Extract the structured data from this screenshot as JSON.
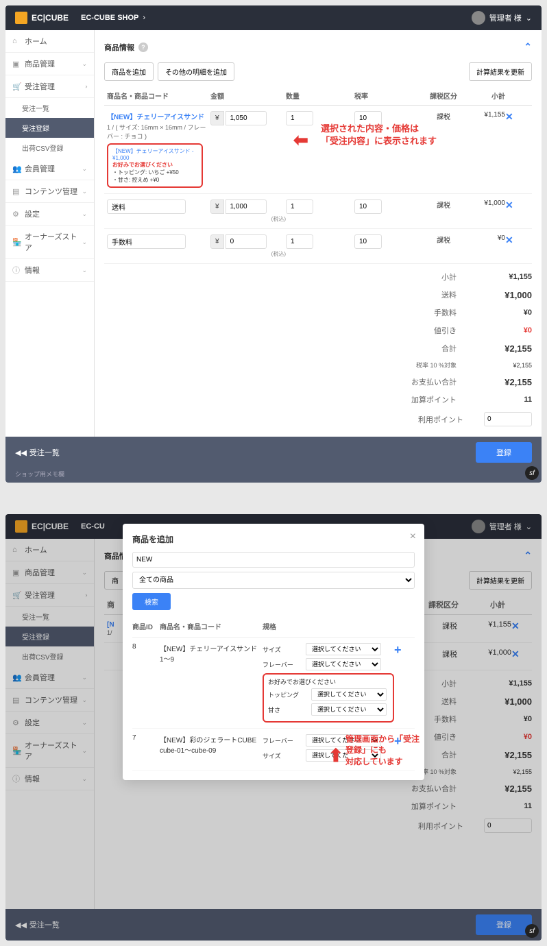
{
  "header": {
    "brand": "EC|CUBE",
    "shop": "EC-CUBE SHOP",
    "user": "管理者 様"
  },
  "sidebar": {
    "home": "ホーム",
    "product": "商品管理",
    "order": "受注管理",
    "orderList": "受注一覧",
    "orderReg": "受注登録",
    "shipCsv": "出荷CSV登録",
    "member": "会員管理",
    "contents": "コンテンツ管理",
    "settings": "設定",
    "owners": "オーナーズストア",
    "info": "情報"
  },
  "section": {
    "title": "商品情報"
  },
  "buttons": {
    "addProduct": "商品を追加",
    "addOther": "その他の明細を追加",
    "recalc": "計算結果を更新",
    "register": "登録",
    "search": "検索"
  },
  "cols": {
    "name": "商品名・商品コード",
    "amount": "金額",
    "qty": "数量",
    "taxRate": "税率",
    "taxCat": "課税区分",
    "subtotal": "小計"
  },
  "rows": {
    "p1": {
      "title": "【NEW】チェリーアイスサンド",
      "desc": "1 / ( サイズ: 16mm × 16mm / フレーバー : チョコ )",
      "calloutLink": "【NEW】チェリーアイスサンド - ¥1,000",
      "calloutHead": "お好みでお選びください",
      "calloutL1": "・トッピング: いちご  +¥50",
      "calloutL2": "・甘さ: 控えめ  +¥0",
      "amount": "1,050",
      "qty": "1",
      "tax": "10",
      "cat": "課税",
      "sub": "¥1,155"
    },
    "ship": {
      "name": "送料",
      "amount": "1,000",
      "qty": "1",
      "tax": "10",
      "cat": "課税",
      "sub": "¥1,000",
      "note": "(税込)"
    },
    "fee": {
      "name": "手数料",
      "amount": "0",
      "qty": "1",
      "tax": "10",
      "cat": "課税",
      "sub": "¥0",
      "note": "(税込)"
    }
  },
  "totals": {
    "subtotal": {
      "lbl": "小計",
      "val": "¥1,155"
    },
    "ship": {
      "lbl": "送料",
      "val": "¥1,000"
    },
    "fee": {
      "lbl": "手数料",
      "val": "¥0"
    },
    "discount": {
      "lbl": "値引き",
      "val": "¥0"
    },
    "total": {
      "lbl": "合計",
      "val": "¥2,155"
    },
    "taxTarget": {
      "lbl": "税率 10 %対象",
      "val": "¥2,155"
    },
    "payTotal": {
      "lbl": "お支払い合計",
      "val": "¥2,155"
    },
    "addPts": {
      "lbl": "加算ポイント",
      "val": "11"
    },
    "usePts": {
      "lbl": "利用ポイント",
      "val": "0"
    }
  },
  "footer": {
    "back": "受注一覧",
    "memo": "ショップ用メモ欄"
  },
  "annot1": {
    "l1": "選択された内容・価格は",
    "l2": "「受注内容」に表示されます"
  },
  "annot2": {
    "l1": "管理画面から「受注登録」にも",
    "l2": "対応しています"
  },
  "modal": {
    "title": "商品を追加",
    "close": "×",
    "searchVal": "NEW",
    "catSel": "全ての商品",
    "cols": {
      "id": "商品ID",
      "name": "商品名・商品コード",
      "spec": "規格"
    },
    "r1": {
      "id": "8",
      "name": "【NEW】チェリーアイスサンド",
      "code": "1〜9",
      "size": "サイズ",
      "flavor": "フレーバー",
      "optTitle": "お好みでお選びください",
      "topping": "トッピング",
      "sweet": "甘さ",
      "ph": "選択してください"
    },
    "r2": {
      "id": "7",
      "name": "【NEW】彩のジェラートCUBE",
      "code": "cube-01〜cube-09",
      "flavor": "フレーバー",
      "size": "サイズ",
      "ph": "選択してください",
      "ph2": "選択してくだ"
    }
  }
}
